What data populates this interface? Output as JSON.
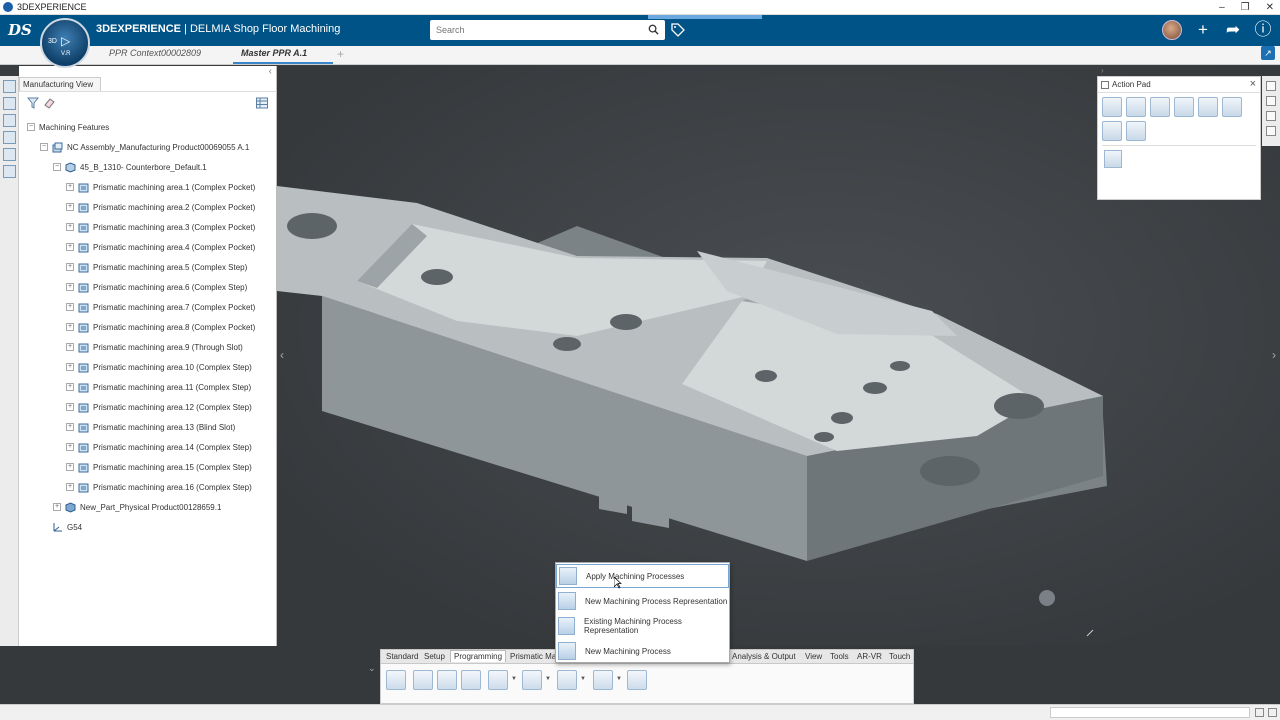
{
  "window": {
    "title": "3DEXPERIENCE"
  },
  "topbar": {
    "brand_bold": "3DEXPERIENCE",
    "brand_rest": " | DELMIA Shop Floor Machining",
    "compass_3d": "3D",
    "compass_vr": "V.R",
    "search_placeholder": "Search",
    "colors": {
      "bar": "#005386",
      "accent": "#3a86c8"
    }
  },
  "tabs": [
    {
      "label": "PPR Context00002809",
      "active": false
    },
    {
      "label": "Master PPR A.1",
      "active": true
    }
  ],
  "tab_add": "+",
  "tree": {
    "panel_title": "Manufacturing View",
    "root": "Machining Features",
    "assembly": "NC Assembly_Manufacturing Product00069055 A.1",
    "feature_group": "45_B_1310- Counterbore_Default.1",
    "areas": [
      "Prismatic machining area.1 (Complex Pocket)",
      "Prismatic machining area.2 (Complex Pocket)",
      "Prismatic machining area.3 (Complex Pocket)",
      "Prismatic machining area.4 (Complex Pocket)",
      "Prismatic machining area.5 (Complex Step)",
      "Prismatic machining area.6 (Complex Step)",
      "Prismatic machining area.7 (Complex Pocket)",
      "Prismatic machining area.8 (Complex Pocket)",
      "Prismatic machining area.9 (Through Slot)",
      "Prismatic machining area.10 (Complex Step)",
      "Prismatic machining area.11 (Complex Step)",
      "Prismatic machining area.12 (Complex Step)",
      "Prismatic machining area.13 (Blind Slot)",
      "Prismatic machining area.14 (Complex Step)",
      "Prismatic machining area.15 (Complex Step)",
      "Prismatic machining area.16 (Complex Step)"
    ],
    "part": "New_Part_Physical Product00128659.1",
    "axis": "G54"
  },
  "action_pad": {
    "title": "Action Pad",
    "close": "×"
  },
  "command_tabs": [
    {
      "label": "Standard",
      "active": false
    },
    {
      "label": "Setup",
      "active": false
    },
    {
      "label": "Programming",
      "active": true
    },
    {
      "label": "Prismatic Ma",
      "active": false
    },
    {
      "label": "Analysis & Output",
      "active": false
    },
    {
      "label": "View",
      "active": false
    },
    {
      "label": "Tools",
      "active": false
    },
    {
      "label": "AR-VR",
      "active": false
    },
    {
      "label": "Touch",
      "active": false
    }
  ],
  "menu": {
    "items": [
      {
        "label": "Apply Machining Processes",
        "highlighted": true
      },
      {
        "label": "New Machining Process Representation",
        "highlighted": false
      },
      {
        "label": "Existing Machining Process Representation",
        "highlighted": false
      },
      {
        "label": "New Machining Process",
        "highlighted": false
      }
    ]
  }
}
